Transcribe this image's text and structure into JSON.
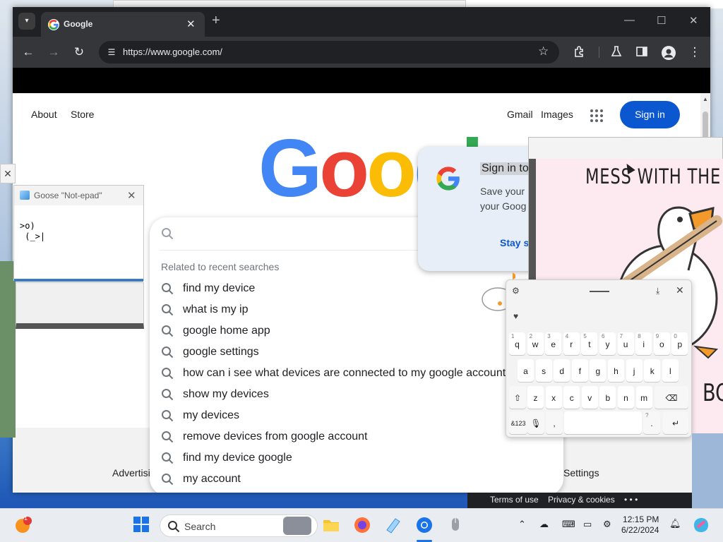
{
  "browser": {
    "tab_title": "Google",
    "new_tab": "+",
    "url": "https://www.google.com/",
    "window_controls": {
      "minimize": "—",
      "maximize": "☐",
      "close": "✕"
    }
  },
  "google": {
    "nav_left": {
      "about": "About",
      "store": "Store"
    },
    "nav_right": {
      "gmail": "Gmail",
      "images": "Images",
      "signin": "Sign in"
    },
    "logo": {
      "letters": [
        "G",
        "o",
        "o",
        "g",
        "l"
      ],
      "colors": [
        "#4285f4",
        "#ea4335",
        "#fbbc05",
        "#4285f4",
        "#34a853"
      ]
    },
    "footer": {
      "advertising": "Advertisi",
      "settings": "Settings"
    }
  },
  "suggestions": {
    "header": "Related to recent searches",
    "items": [
      "find my device",
      "what is my ip",
      "google home app",
      "google settings",
      "how can i see what devices are connected to my google account",
      "show my devices",
      "my devices",
      "remove devices from google account",
      "find my device google",
      "my account"
    ]
  },
  "signin_popup": {
    "title": "Sign in to",
    "body": "Save your your Goog",
    "stay": "Stay s"
  },
  "notepad": {
    "title": "Goose \"Not-epad\"",
    "close": "✕",
    "content": ">o)\n (_>|"
  },
  "meme": {
    "top_text": "MESS WITH THE HO",
    "bottom_text": "BO"
  },
  "keyboard": {
    "row1": [
      {
        "k": "q",
        "n": "1"
      },
      {
        "k": "w",
        "n": "2"
      },
      {
        "k": "e",
        "n": "3"
      },
      {
        "k": "r",
        "n": "4"
      },
      {
        "k": "t",
        "n": "5"
      },
      {
        "k": "y",
        "n": "6"
      },
      {
        "k": "u",
        "n": "7"
      },
      {
        "k": "i",
        "n": "8"
      },
      {
        "k": "o",
        "n": "9"
      },
      {
        "k": "p",
        "n": "0"
      }
    ],
    "row2": [
      "a",
      "s",
      "d",
      "f",
      "g",
      "h",
      "j",
      "k",
      "l"
    ],
    "row3": [
      "z",
      "x",
      "c",
      "v",
      "b",
      "n",
      "m"
    ],
    "sym_key": "&123",
    "comma": ",",
    "period": ".",
    "period_alt": "?"
  },
  "chrome_footer": {
    "terms": "Terms of use",
    "privacy": "Privacy & cookies",
    "more": "• • •"
  },
  "taskbar": {
    "search_label": "Search",
    "notification_count": "1",
    "time": "12:15 PM",
    "date": "6/22/2024"
  },
  "icons": {
    "back": "arrow-left-icon",
    "forward": "arrow-right-icon",
    "reload": "reload-icon",
    "site_info": "tune-icon",
    "bookmark": "star-icon",
    "extensions": "puzzle-icon",
    "labs": "flask-icon",
    "side_panel": "side-panel-icon",
    "profile": "profile-icon",
    "menu": "kebab-menu-icon"
  },
  "colors": {
    "signin_blue": "#0b57d0",
    "chrome_dark": "#202124",
    "toolbar": "#35363a"
  }
}
